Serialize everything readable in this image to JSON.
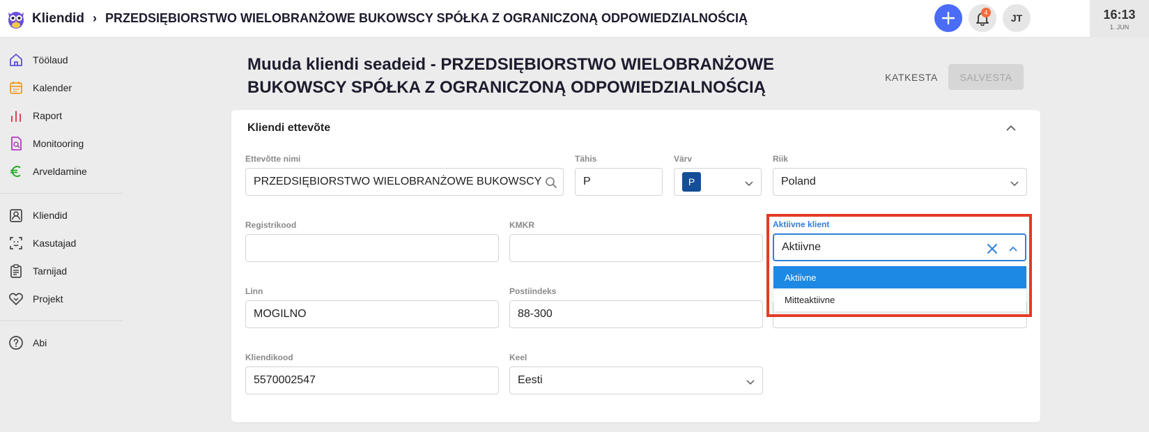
{
  "topbar": {
    "breadcrumb_root": "Kliendid",
    "breadcrumb_sep": "›",
    "breadcrumb_current": "PRZEDSIĘBIORSTWO WIELOBRANŻOWE BUKOWSCY SPÓŁKA Z OGRANICZONĄ ODPOWIEDZIALNOŚCIĄ",
    "notifications_count": "4",
    "avatar_initials": "JT",
    "clock_time": "16:13",
    "clock_date": "1. JUN"
  },
  "sidebar": {
    "items": [
      {
        "label": "Töölaud",
        "icon": "home-icon"
      },
      {
        "label": "Kalender",
        "icon": "calendar-icon"
      },
      {
        "label": "Raport",
        "icon": "bar-chart-icon"
      },
      {
        "label": "Monitooring",
        "icon": "monitor-doc-icon"
      },
      {
        "label": "Arveldamine",
        "icon": "euro-icon"
      },
      {
        "label": "Kliendid",
        "icon": "client-badge-icon"
      },
      {
        "label": "Kasutajad",
        "icon": "face-scan-icon"
      },
      {
        "label": "Tarnijad",
        "icon": "clipboard-icon"
      },
      {
        "label": "Projekt",
        "icon": "handshake-icon"
      },
      {
        "label": "Abi",
        "icon": "help-icon"
      }
    ]
  },
  "page": {
    "title_line1": "Muuda kliendi seadeid - PRZEDSIĘBIORSTWO WIELOBRANŻOWE",
    "title_line2": "BUKOWSCY SPÓŁKA Z OGRANICZONĄ ODPOWIEDZIALNOŚCIĄ",
    "cancel_label": "KATKESTA",
    "save_label": "SALVESTA"
  },
  "card": {
    "title": "Kliendi ettevõte",
    "fields": {
      "company_name": {
        "label": "Ettevõtte nimi",
        "value": "PRZEDSIĘBIORSTWO WIELOBRANŻOWE BUKOWSCY"
      },
      "tahis": {
        "label": "Tähis",
        "value": "P"
      },
      "varv": {
        "label": "Värv",
        "value": "P"
      },
      "riik": {
        "label": "Riik",
        "value": "Poland"
      },
      "registrikood": {
        "label": "Registrikood",
        "value": ""
      },
      "kmkr": {
        "label": "KMKR",
        "value": ""
      },
      "aktiivne": {
        "label": "Aktiivne klient",
        "value": "Aktiivne"
      },
      "linn": {
        "label": "Linn",
        "value": "MOGILNO"
      },
      "postiindeks": {
        "label": "Postiindeks",
        "value": "88-300"
      },
      "kliendikood": {
        "label": "Kliendikood",
        "value": "5570002547"
      },
      "keel": {
        "label": "Keel",
        "value": "Eesti"
      }
    },
    "active_options": [
      "Aktiivne",
      "Mitteaktiivne"
    ]
  },
  "colors": {
    "accent": "#4a6cf7",
    "focus_blue": "#2f7fd8",
    "selected_option": "#1e88e5",
    "highlight_red": "#e43b26",
    "color_chip": "#144e96"
  }
}
